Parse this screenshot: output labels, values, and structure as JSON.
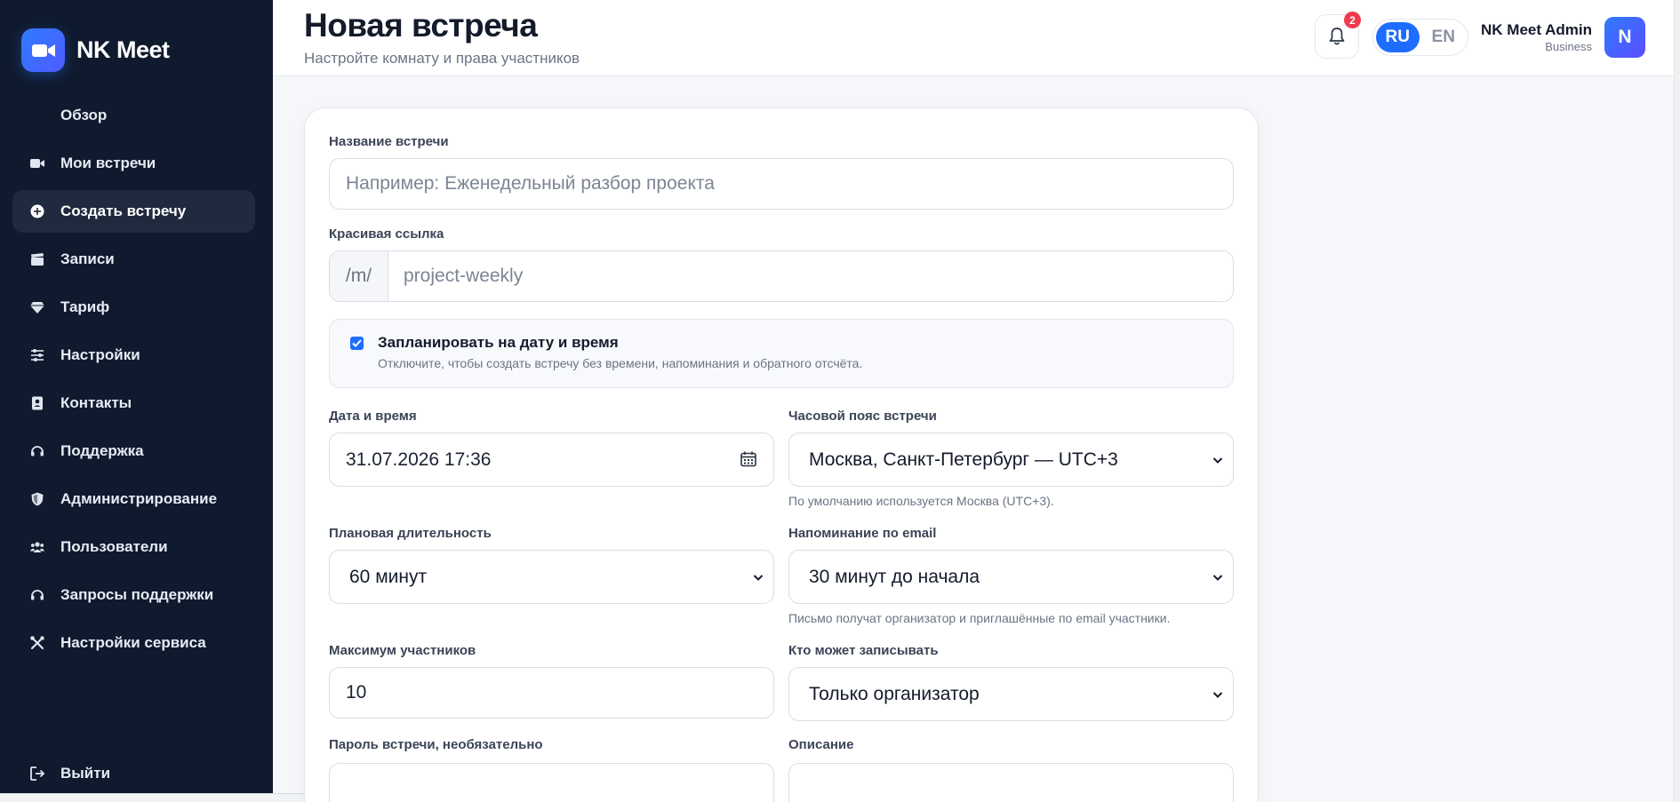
{
  "brand": {
    "name": "NK Meet",
    "accent": "#2f7bff"
  },
  "sidebar": {
    "items": [
      {
        "label": "Обзор",
        "icon": "none"
      },
      {
        "label": "Мои встречи",
        "icon": "video-icon"
      },
      {
        "label": "Создать встречу",
        "icon": "plus-circle-icon",
        "active": true
      },
      {
        "label": "Записи",
        "icon": "clapperboard-icon"
      },
      {
        "label": "Тариф",
        "icon": "gem-icon"
      },
      {
        "label": "Настройки",
        "icon": "sliders-icon"
      },
      {
        "label": "Контакты",
        "icon": "contact-card-icon"
      },
      {
        "label": "Поддержка",
        "icon": "headset-icon"
      },
      {
        "label": "Администрирование",
        "icon": "shield-icon"
      },
      {
        "label": "Пользователи",
        "icon": "users-icon"
      },
      {
        "label": "Запросы поддержки",
        "icon": "headset-icon"
      },
      {
        "label": "Настройки сервиса",
        "icon": "tools-icon"
      }
    ],
    "logout_label": "Выйти"
  },
  "header": {
    "title": "Новая встреча",
    "subtitle": "Настройте комнату и права участников",
    "notifications_count": "2",
    "lang": {
      "ru": "RU",
      "en": "EN",
      "active": "RU"
    },
    "user": {
      "name": "NK Meet Admin",
      "plan": "Business",
      "initial": "N"
    }
  },
  "form": {
    "meeting_name": {
      "label": "Название встречи",
      "placeholder": "Например: Еженедельный разбор проекта"
    },
    "slug": {
      "label": "Красивая ссылка",
      "prefix": "/m/",
      "placeholder": "project-weekly"
    },
    "schedule": {
      "checked": true,
      "title": "Запланировать на дату и время",
      "description": "Отключите, чтобы создать встречу без времени, напоминания и обратного отсчёта."
    },
    "datetime": {
      "label": "Дата и время",
      "value": "31.07.2026 17:36"
    },
    "timezone": {
      "label": "Часовой пояс встречи",
      "value": "Москва, Санкт-Петербург — UTC+3",
      "hint": "По умолчанию используется Москва (UTC+3)."
    },
    "duration": {
      "label": "Плановая длительность",
      "value": "60 минут"
    },
    "reminder": {
      "label": "Напоминание по email",
      "value": "30 минут до начала",
      "hint": "Письмо получат организатор и приглашённые по email участники."
    },
    "max_participants": {
      "label": "Максимум участников",
      "value": "10"
    },
    "recording": {
      "label": "Кто может записывать",
      "value": "Только организатор"
    },
    "password": {
      "label": "Пароль встречи, необязательно",
      "value": ""
    },
    "description": {
      "label": "Описание",
      "value": ""
    }
  }
}
